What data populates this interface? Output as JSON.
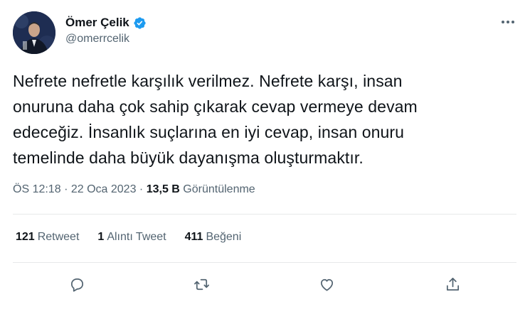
{
  "author": {
    "name": "Ömer Çelik",
    "handle": "@omerrcelik",
    "verified": true,
    "verified_color": "#1d9bf0"
  },
  "tweet": {
    "text_lines": [
      "Nefrete nefretle karşılık verilmez. Nefrete karşı, insan",
      "onuruna daha çok sahip çıkarak cevap vermeye devam",
      "edeceğiz. İnsanlık suçlarına en iyi cevap, insan onuru",
      "temelinde daha büyük dayanışma oluşturmaktır."
    ],
    "time": "ÖS 12:18",
    "separator": "·",
    "date": "22 Oca 2023",
    "views_count": "13,5 B",
    "views_label": "Görüntülenme"
  },
  "stats": {
    "retweets": {
      "count": "121",
      "label": "Retweet"
    },
    "quotes": {
      "count": "1",
      "label": "Alıntı Tweet"
    },
    "likes": {
      "count": "411",
      "label": "Beğeni"
    }
  },
  "icons": {
    "more": "more-icon",
    "reply": "reply-icon",
    "retweet": "retweet-icon",
    "like": "like-icon",
    "share": "share-icon"
  },
  "colors": {
    "text": "#0f1419",
    "secondary": "#536471",
    "divider": "#e7e9ea"
  }
}
